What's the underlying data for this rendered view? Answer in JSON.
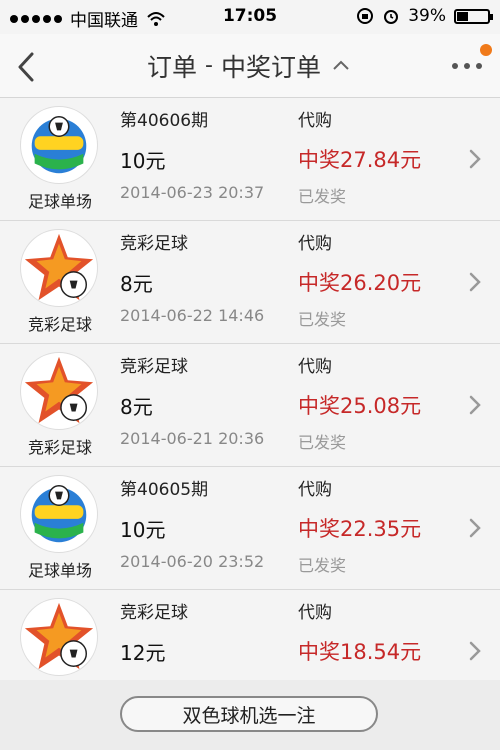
{
  "status_bar": {
    "carrier": "中国联通",
    "time": "17:05",
    "battery": "39%",
    "battery_fraction": 0.39
  },
  "nav": {
    "title": "订单",
    "dash": "-",
    "subtitle": "中奖订单"
  },
  "orders": [
    {
      "game": "足球单场",
      "logo": "football-single-logo",
      "period": "第40606期",
      "amount": "10元",
      "datetime": "2014-06-23 20:37",
      "type": "代购",
      "prize": "中奖27.84元",
      "state": "已发奖"
    },
    {
      "game": "竞彩足球",
      "logo": "jingcai-football-logo",
      "period": "竞彩足球",
      "amount": "8元",
      "datetime": "2014-06-22 14:46",
      "type": "代购",
      "prize": "中奖26.20元",
      "state": "已发奖"
    },
    {
      "game": "竞彩足球",
      "logo": "jingcai-football-logo",
      "period": "竞彩足球",
      "amount": "8元",
      "datetime": "2014-06-21 20:36",
      "type": "代购",
      "prize": "中奖25.08元",
      "state": "已发奖"
    },
    {
      "game": "足球单场",
      "logo": "football-single-logo",
      "period": "第40605期",
      "amount": "10元",
      "datetime": "2014-06-20 23:52",
      "type": "代购",
      "prize": "中奖22.35元",
      "state": "已发奖"
    },
    {
      "game": "竞彩足球",
      "logo": "jingcai-football-logo",
      "period": "竞彩足球",
      "amount": "12元",
      "datetime": "",
      "type": "代购",
      "prize": "中奖18.54元",
      "state": ""
    }
  ],
  "footer": {
    "button_label": "双色球机选一注"
  },
  "colors": {
    "prize": "#c62828",
    "badge": "#f07a1a"
  }
}
